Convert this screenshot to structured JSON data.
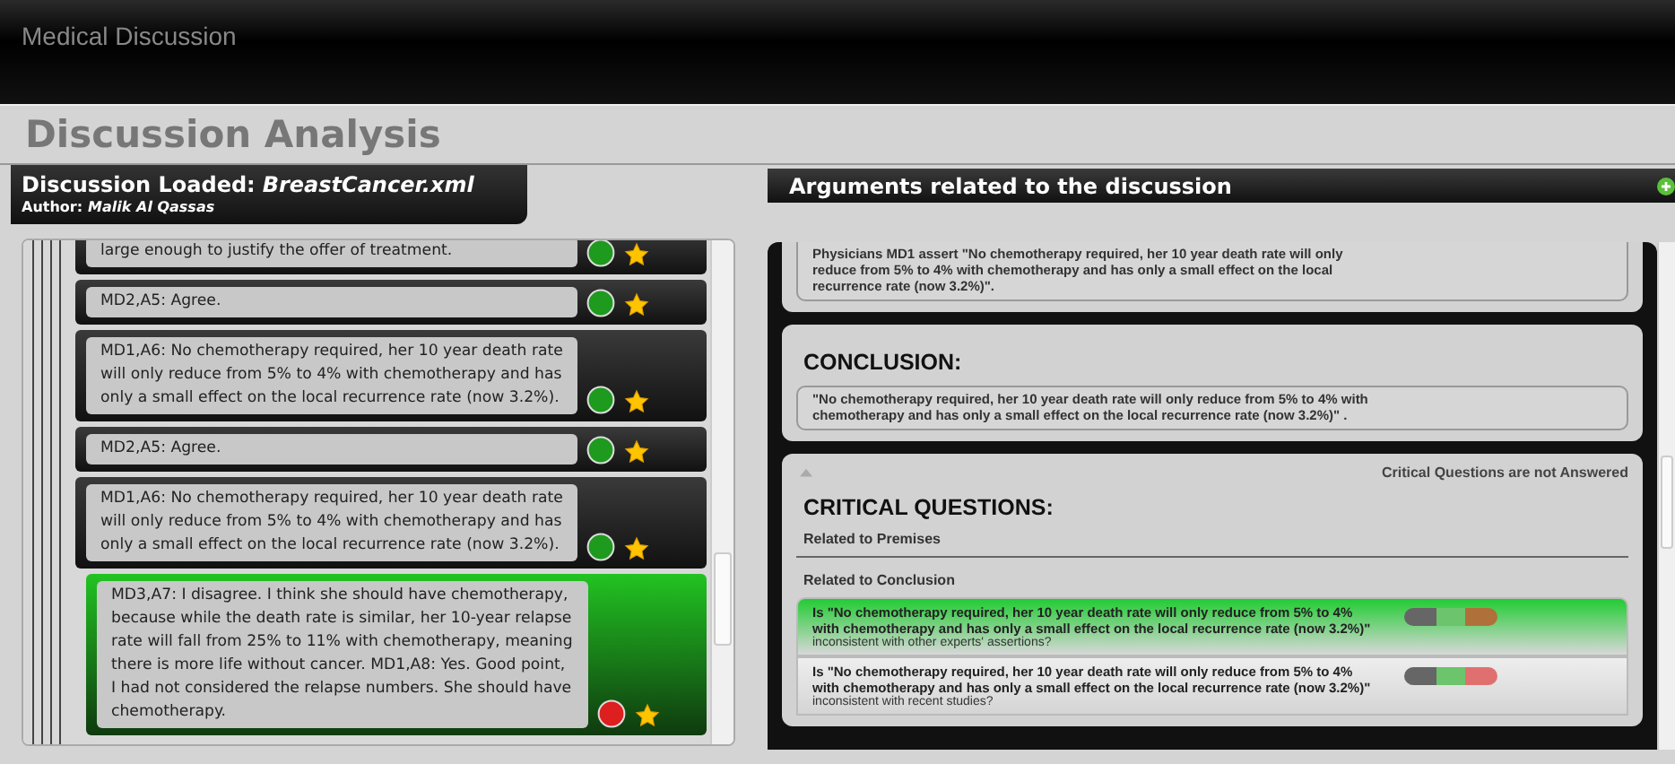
{
  "window": {
    "title": "Medical Discussion"
  },
  "heading": "Discussion Analysis",
  "discussion": {
    "label": "Discussion Loaded:",
    "file": "BreastCancer.xml",
    "author_label": "Author:",
    "author": "Malik Al Qassas",
    "items": [
      {
        "text": "large enough to justify the offer of treatment.",
        "color": "#1e9a1e",
        "starred": true,
        "selected": false
      },
      {
        "text": "MD2,A5: Agree.",
        "color": "#1e9a1e",
        "starred": true,
        "selected": false
      },
      {
        "text": "MD1,A6: No chemotherapy required, her 10 year death rate will only reduce from 5% to 4% with chemotherapy and has only a small effect on the local recurrence rate (now 3.2%).",
        "color": "#1e9a1e",
        "starred": true,
        "selected": false
      },
      {
        "text": "MD2,A5: Agree.",
        "color": "#1e9a1e",
        "starred": true,
        "selected": false
      },
      {
        "text": "MD1,A6: No chemotherapy required, her 10 year death rate will only reduce from 5% to 4% with chemotherapy and has only a small effect on the local recurrence rate (now 3.2%).",
        "color": "#1e9a1e",
        "starred": true,
        "selected": false,
        "children": [
          {
            "text": "MD3,A7: I disagree. I think she should have chemotherapy, because while the death rate is similar, her 10-year relapse rate will fall from 25% to 11% with chemotherapy, meaning there is more life without cancer. MD1,A8: Yes. Good point, I had not considered the relapse numbers. She should have chemotherapy.",
            "color": "#dd1f1f",
            "starred": true,
            "selected": true
          }
        ]
      }
    ]
  },
  "arguments": {
    "title": "Arguments related to the discussion",
    "premise": "Physicians MD1 assert \"No chemotherapy required, her 10 year death rate will only reduce from 5% to 4% with chemotherapy and has only a small effect on the local recurrence rate (now 3.2%)\".",
    "conclusion": {
      "title": "CONCLUSION:",
      "text": "\"No chemotherapy required, her 10 year death rate will only reduce from 5% to 4% with chemotherapy and has only a small effect on the local recurrence rate (now 3.2%)\" ."
    },
    "critical": {
      "status": "Critical Questions are not Answered",
      "title": "CRITICAL QUESTIONS:",
      "premises_label": "Related to Premises",
      "conclusion_label": "Related to Conclusion",
      "questions": [
        {
          "text": "Is \"No chemotherapy required, her 10 year death rate will only reduce from 5% to 4% with chemotherapy and has only a small effect on the local recurrence rate (now 3.2%)\"",
          "note": "inconsistent with other experts' assertions?",
          "selected": true
        },
        {
          "text": "Is \"No chemotherapy required, her 10 year death rate will only reduce from 5% to 4% with chemotherapy and has only a small effect on the local recurrence rate (now 3.2%)\"",
          "note": "inconsistent with recent studies?",
          "selected": false
        }
      ]
    }
  }
}
